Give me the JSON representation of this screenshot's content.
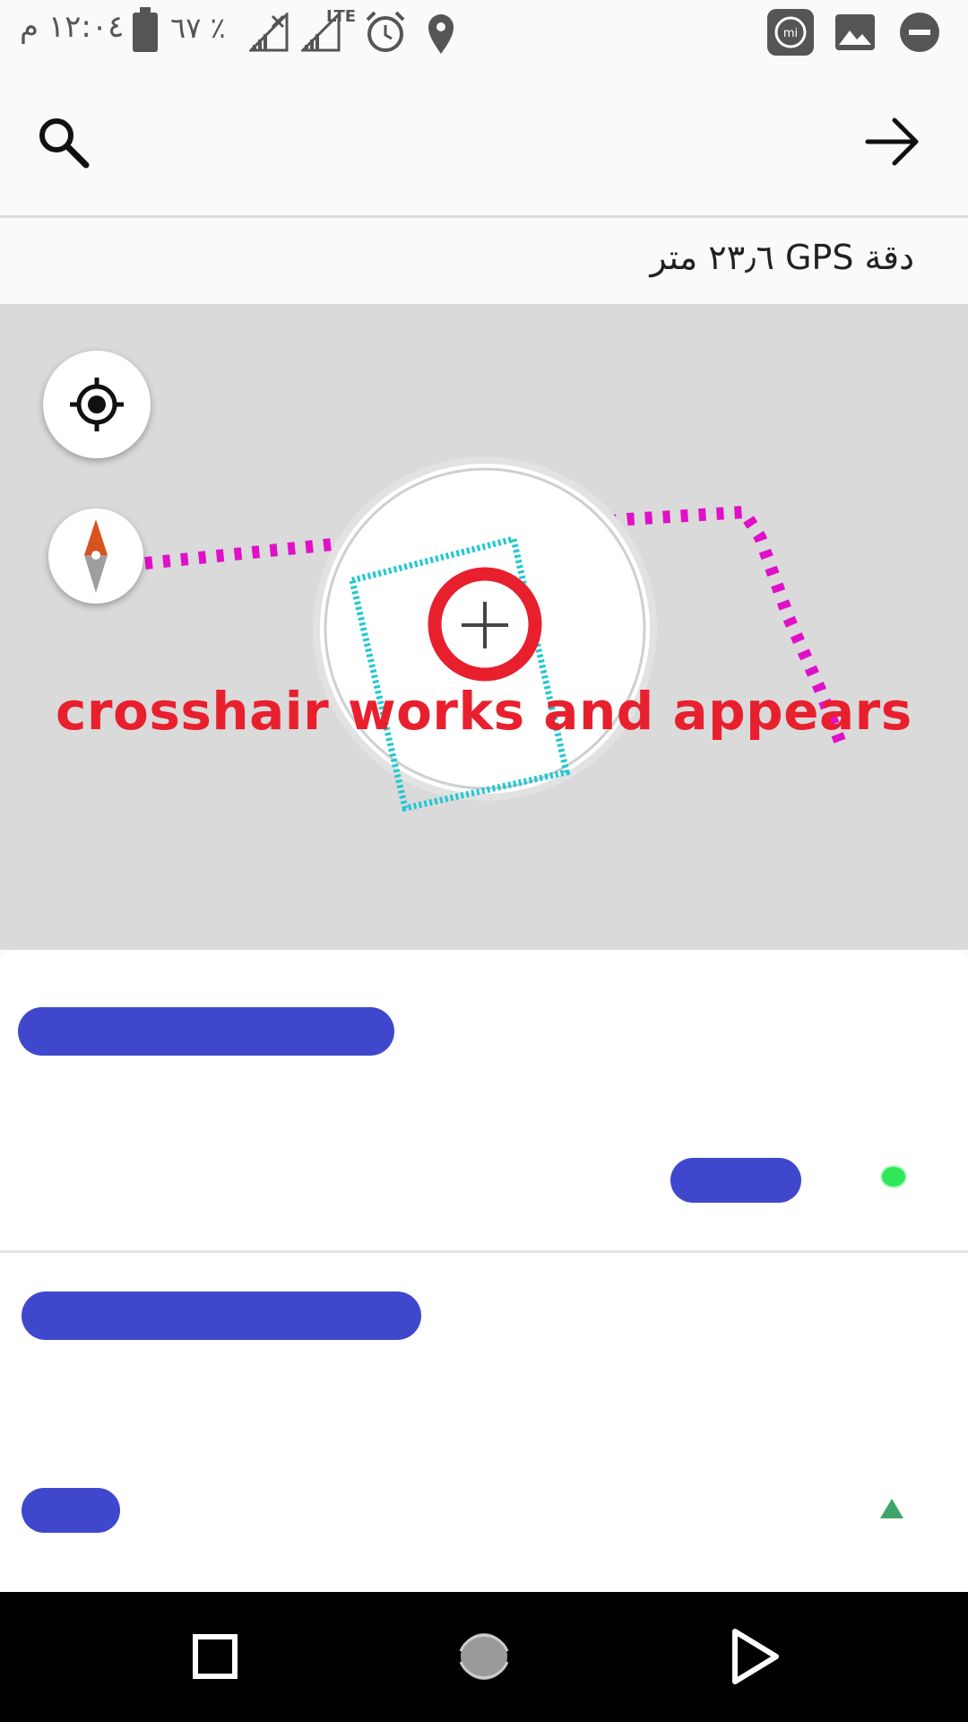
{
  "status_bar": {
    "time": "١٢:٠٤ م",
    "battery_percent": "٦٧ ٪",
    "network_label": "LTE",
    "icons": [
      "battery-icon",
      "signal-icon",
      "signal-lte-icon",
      "alarm-icon",
      "location-icon",
      "mi-app-icon",
      "gallery-icon",
      "do-not-disturb-icon"
    ]
  },
  "app_bar": {
    "icons": [
      "search-icon",
      "forward-arrow-icon"
    ]
  },
  "gps": {
    "accuracy_text": "دقة GPS ٢٣٫٦ متر"
  },
  "map": {
    "annotation": "crosshair works and appears",
    "colors": {
      "track": "#e010c8",
      "polygon": "#1ec8d2",
      "highlight_ring": "#e8202e",
      "background": "#dadada"
    },
    "icons": [
      "my-location-icon",
      "compass-icon",
      "crosshair-icon"
    ]
  },
  "list": {
    "items": [
      {
        "status_icon": "green-dot-icon",
        "status_color": "#2ee85a"
      },
      {
        "status_icon": "triangle-icon",
        "status_color": "#3ea46a"
      }
    ],
    "redaction_color": "#3f48cc"
  },
  "nav_bar": {
    "icons": [
      "recents-square-icon",
      "home-circle-icon",
      "back-triangle-icon"
    ]
  }
}
